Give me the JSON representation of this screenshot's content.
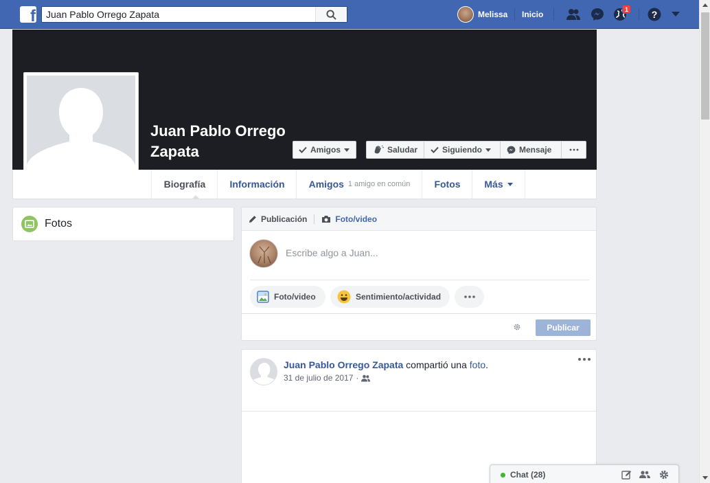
{
  "topbar": {
    "search_value": "Juan Pablo Orrego Zapata",
    "user_name": "Melissa",
    "home_label": "Inicio",
    "notifications_count": "1"
  },
  "profile": {
    "name": "Juan Pablo Orrego Zapata"
  },
  "cover_buttons": {
    "friends": "Amigos",
    "greet": "Saludar",
    "following": "Siguiendo",
    "message": "Mensaje"
  },
  "tabs": [
    {
      "label": "Biografía"
    },
    {
      "label": "Información"
    },
    {
      "label": "Amigos",
      "sub": "1 amigo en común"
    },
    {
      "label": "Fotos"
    },
    {
      "label": "Más"
    }
  ],
  "sidebar": {
    "photos_label": "Fotos"
  },
  "composer": {
    "tab_post": "Publicación",
    "tab_photo": "Foto/video",
    "placeholder": "Escribe algo a Juan...",
    "photo_video": "Foto/video",
    "feeling": "Sentimiento/actividad",
    "publish": "Publicar"
  },
  "post": {
    "author": "Juan Pablo Orrego Zapata",
    "action": "compartió una",
    "object": "foto",
    "period": ".",
    "date": "31 de julio de 2017",
    "date_sep": "·"
  },
  "chat": {
    "label": "Chat (28)"
  },
  "colors": {
    "brand": "#4267b2",
    "cover": "#1c1e24",
    "online": "#42b72a",
    "badge": "#fa3e3e"
  }
}
